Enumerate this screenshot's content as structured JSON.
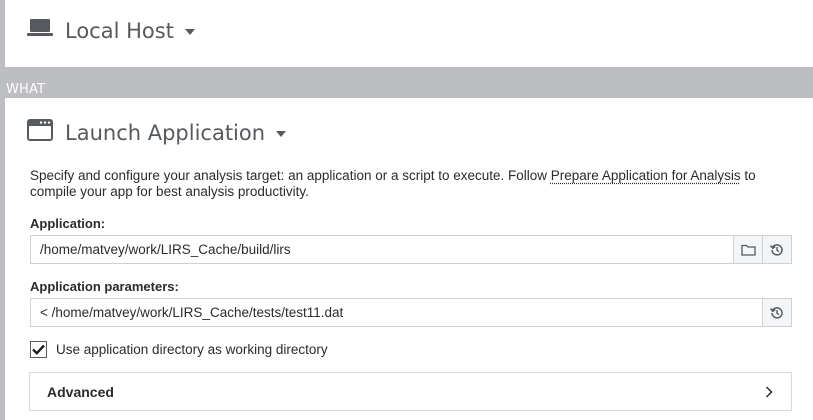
{
  "where": {
    "title": "Local Host",
    "icon": "laptop-icon"
  },
  "band": {
    "label": "WHAT"
  },
  "what": {
    "title": "Launch Application",
    "icon": "app-window-icon",
    "description_before": "Specify and configure your analysis target: an application or a script to execute. Follow ",
    "description_link": "Prepare Application for Analysis",
    "description_after": " to compile your app for best analysis productivity.",
    "application": {
      "label": "Application:",
      "value": "/home/matvey/work/LIRS_Cache/build/lirs"
    },
    "parameters": {
      "label": "Application parameters:",
      "value": "< /home/matvey/work/LIRS_Cache/tests/test11.dat"
    },
    "working_dir": {
      "label": "Use application directory as working directory",
      "checked": true
    },
    "advanced": {
      "label": "Advanced"
    }
  },
  "colors": {
    "band": "#bcbec1",
    "text": "#2b2b2b",
    "header_text": "#56595d",
    "border": "#cfd1d4"
  }
}
